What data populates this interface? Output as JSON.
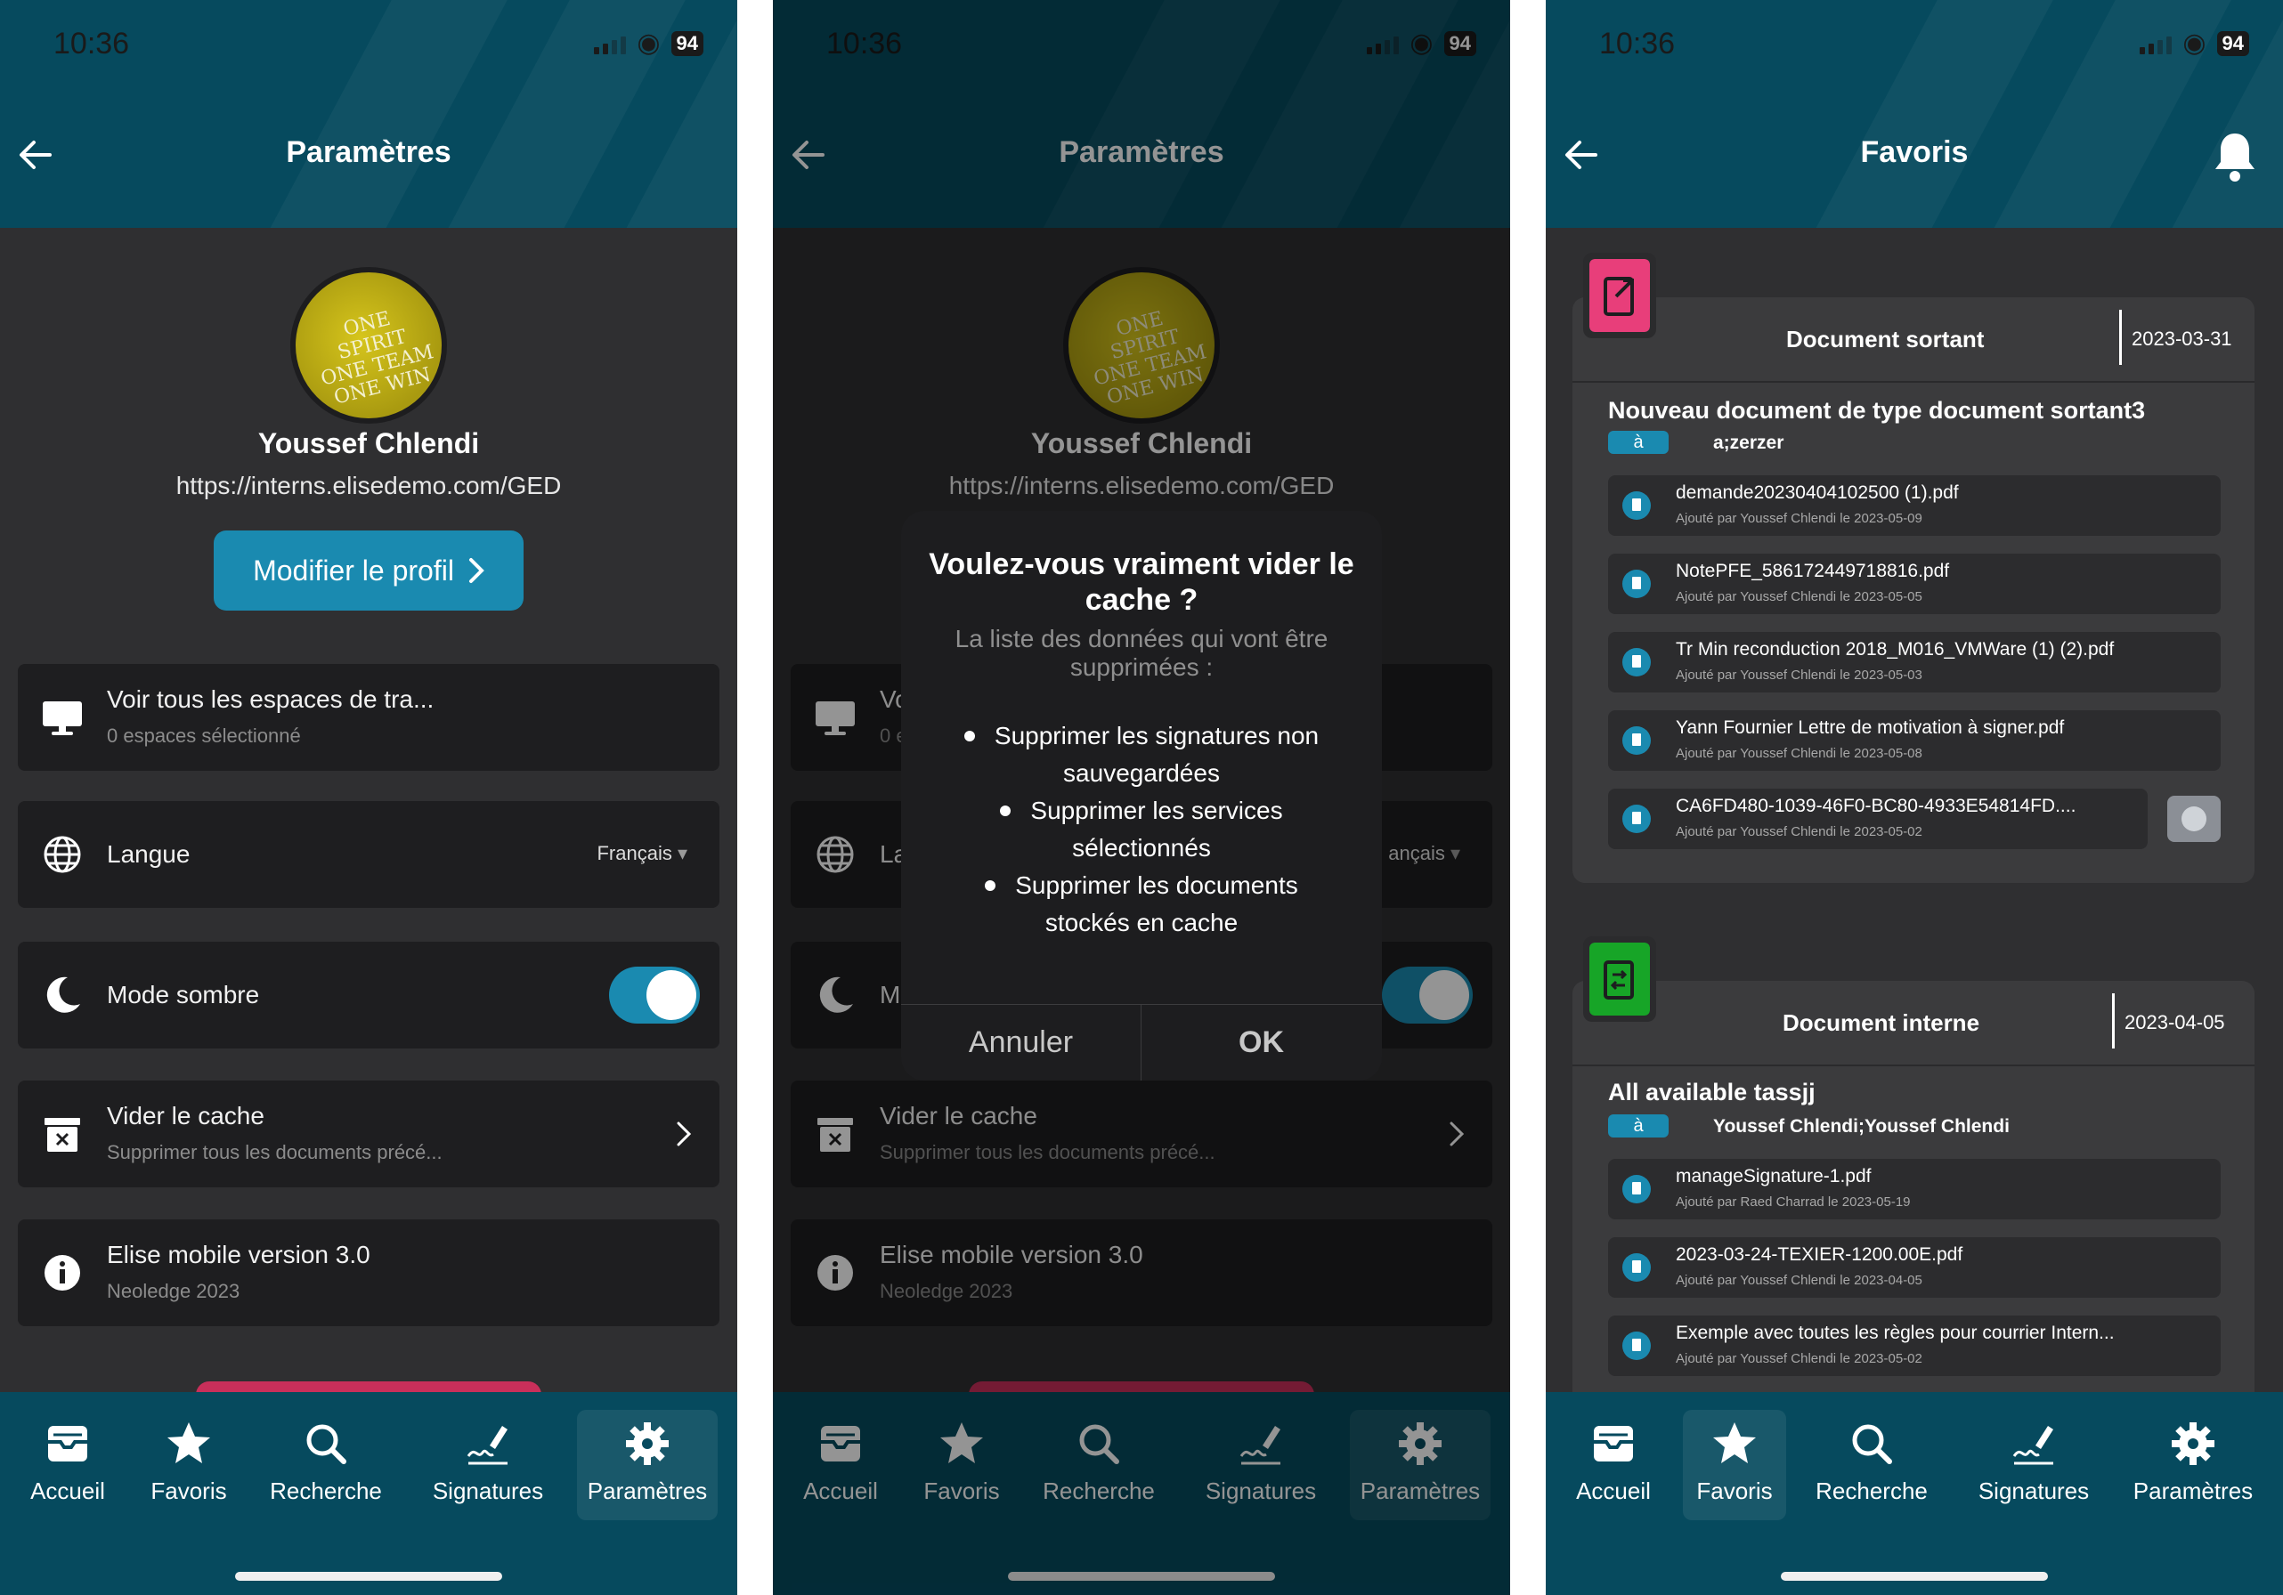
{
  "status_bar": {
    "time": "10:36",
    "battery": "94"
  },
  "colors": {
    "header": "#064a5e",
    "accent": "#1a8ab0",
    "card": "#1e1e20",
    "background": "#2f2f31",
    "outgoing_badge": "#e83e7a",
    "internal_badge": "#17a527"
  },
  "screen_settings": {
    "title": "Paramètres",
    "back_icon": "arrow-left-icon",
    "profile": {
      "name": "Youssef Chlendi",
      "url": "https://interns.elisedemo.com/GED",
      "edit_label": "Modifier le profil",
      "avatar_text": [
        "ONE SPIRIT",
        "ONE TEAM",
        "ONE WIN"
      ]
    },
    "rows": {
      "workspaces": {
        "title": "Voir tous les espaces de tra...",
        "subtitle": "0 espaces sélectionné",
        "icon": "monitor-icon"
      },
      "language": {
        "title": "Langue",
        "value": "Français",
        "icon": "globe-icon"
      },
      "dark_mode": {
        "title": "Mode sombre",
        "enabled": true,
        "icon": "moon-icon"
      },
      "clear_cache": {
        "title": "Vider le cache",
        "subtitle": "Supprimer tous les documents précé...",
        "icon": "archive-x-icon"
      },
      "version": {
        "title": "Elise mobile version 3.0",
        "subtitle": "Neoledge 2023",
        "icon": "info-icon"
      }
    }
  },
  "dialog": {
    "title": "Voulez-vous vraiment vider le cache ?",
    "message": "La liste des données qui vont être supprimées :",
    "items": [
      [
        "Supprimer les signatures non",
        "sauvegardées"
      ],
      [
        "Supprimer les services",
        "sélectionnés"
      ],
      [
        "Supprimer les documents",
        "stockés en cache"
      ]
    ],
    "cancel_label": "Annuler",
    "ok_label": "OK",
    "partial": {
      "workspaces_title": "Vo",
      "workspaces_sub": "0 e",
      "language_title": "La",
      "language_value": "ançais",
      "dark_mode_title": "M"
    }
  },
  "screen_favorites": {
    "title": "Favoris",
    "bell_icon": "bell-icon",
    "groups": [
      {
        "type": "Document sortant",
        "date": "2023-03-31",
        "icon": "doc-out-icon",
        "subject": "Nouveau document de type document sortant3",
        "recipient_tag": "à",
        "recipients": "a;zerzer",
        "files": [
          {
            "name": "demande20230404102500 (1).pdf",
            "meta": "Ajouté par Youssef Chlendi le 2023-05-09"
          },
          {
            "name": "NotePFE_586172449718816.pdf",
            "meta": "Ajouté par Youssef Chlendi le 2023-05-05"
          },
          {
            "name": "Tr Min reconduction 2018_M016_VMWare (1) (2).pdf",
            "meta": "Ajouté par Youssef Chlendi le 2023-05-03"
          },
          {
            "name": "Yann Fournier Lettre de motivation à signer.pdf",
            "meta": "Ajouté par Youssef Chlendi le 2023-05-08"
          },
          {
            "name": "CA6FD480-1039-46F0-BC80-4933E54814FD....",
            "meta": "Ajouté par Youssef Chlendi le 2023-05-02"
          }
        ]
      },
      {
        "type": "Document interne",
        "date": "2023-04-05",
        "icon": "doc-internal-icon",
        "subject": "All available tassjj",
        "recipient_tag": "à",
        "recipients": "Youssef Chlendi;Youssef Chlendi",
        "files": [
          {
            "name": "manageSignature-1.pdf",
            "meta": "Ajouté par Raed Charrad le 2023-05-19"
          },
          {
            "name": "2023-03-24-TEXIER-1200.00E.pdf",
            "meta": "Ajouté par Youssef Chlendi le 2023-04-05"
          },
          {
            "name": "Exemple avec toutes les règles pour courrier Intern...",
            "meta": "Ajouté par Youssef Chlendi le 2023-05-02"
          }
        ]
      }
    ]
  },
  "nav": {
    "items": [
      {
        "label": "Accueil",
        "icon": "inbox-icon"
      },
      {
        "label": "Favoris",
        "icon": "star-icon"
      },
      {
        "label": "Recherche",
        "icon": "search-icon"
      },
      {
        "label": "Signatures",
        "icon": "signature-icon"
      },
      {
        "label": "Paramètres",
        "icon": "gear-icon"
      }
    ]
  }
}
